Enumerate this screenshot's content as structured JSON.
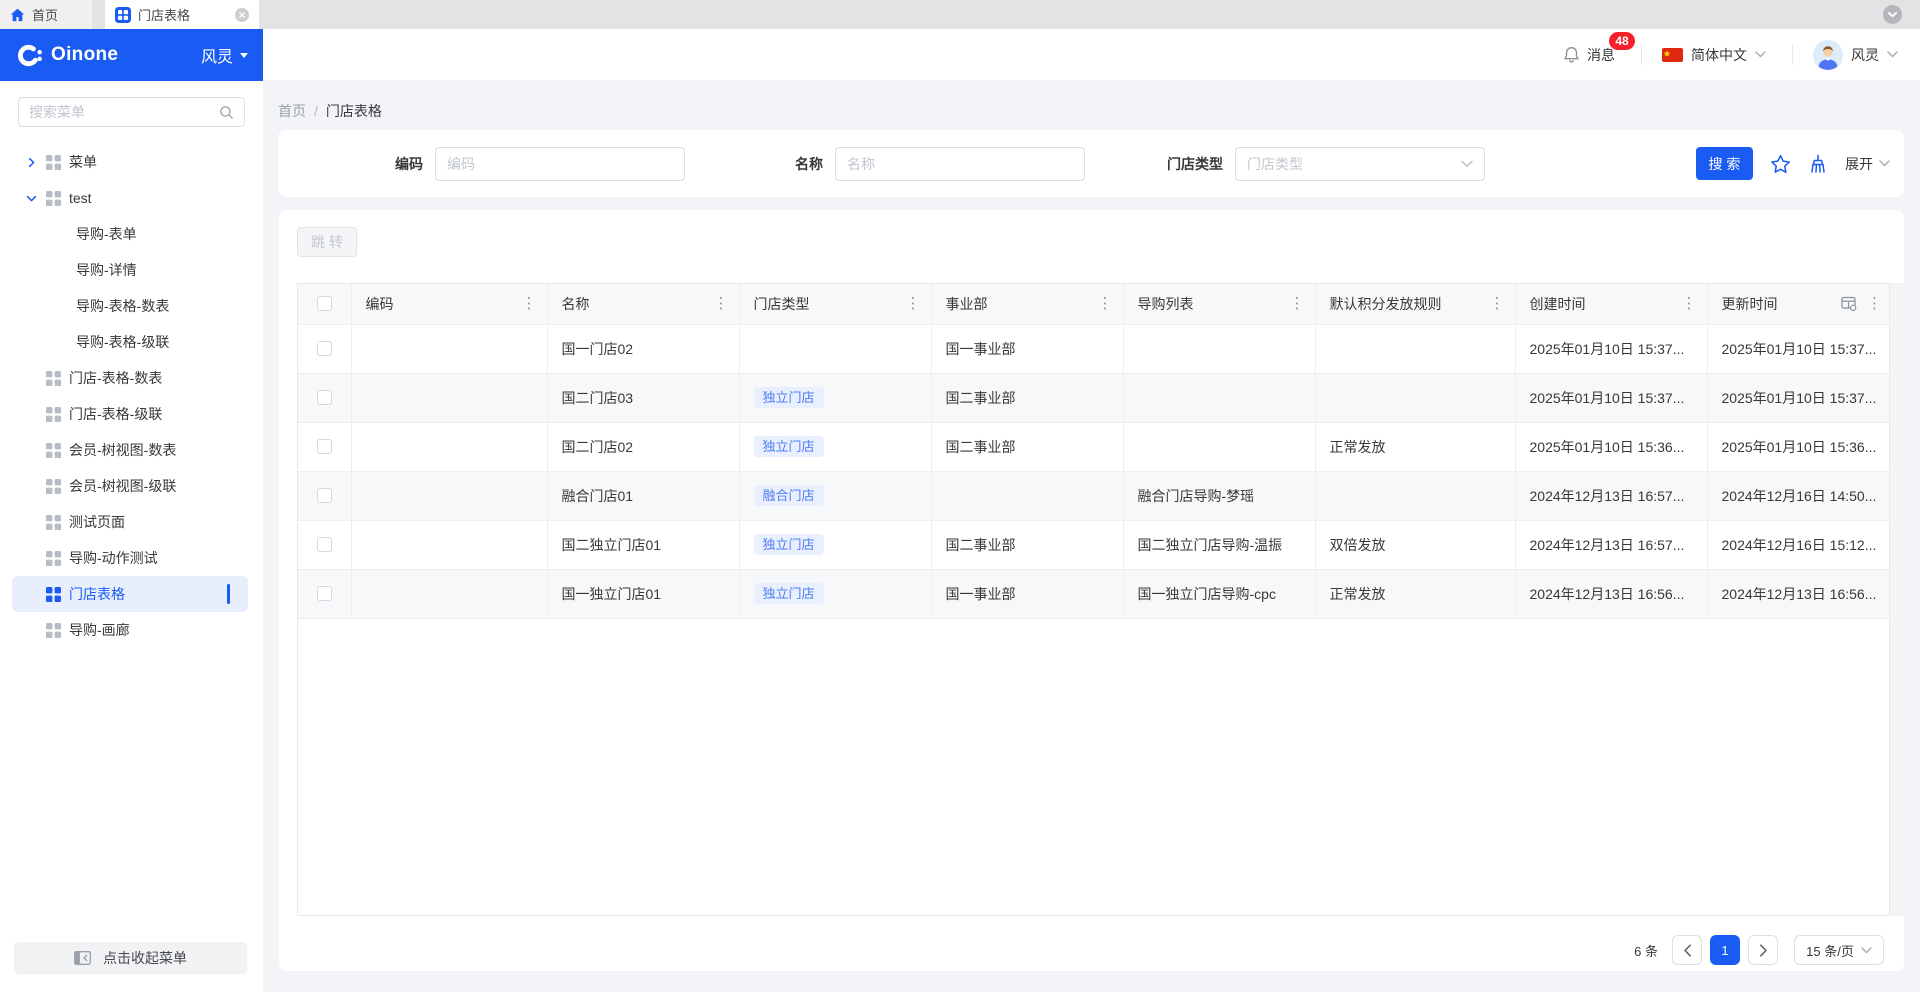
{
  "tab_bar": {
    "tabs": [
      {
        "label": "首页",
        "icon": "home-icon",
        "active": false,
        "closable": false
      },
      {
        "label": "门店表格",
        "icon": "grid-icon",
        "active": true,
        "closable": true
      }
    ]
  },
  "header": {
    "brand": "Oinone",
    "workspace": "风灵",
    "messages": {
      "label": "消息",
      "badge": "48"
    },
    "language": "简体中文",
    "user": "风灵"
  },
  "sidebar": {
    "search_placeholder": "搜索菜单",
    "menu": [
      {
        "label": "菜单",
        "icon": true,
        "chevron": "right",
        "indent": 0,
        "selected": false
      },
      {
        "label": "test",
        "icon": true,
        "chevron": "down",
        "indent": 0,
        "selected": false
      },
      {
        "label": "导购-表单",
        "icon": false,
        "chevron": "",
        "indent": 1,
        "selected": false
      },
      {
        "label": "导购-详情",
        "icon": false,
        "chevron": "",
        "indent": 1,
        "selected": false
      },
      {
        "label": "导购-表格-数表",
        "icon": false,
        "chevron": "",
        "indent": 1,
        "selected": false
      },
      {
        "label": "导购-表格-级联",
        "icon": false,
        "chevron": "",
        "indent": 1,
        "selected": false
      },
      {
        "label": "门店-表格-数表",
        "icon": true,
        "chevron": "",
        "indent": 0,
        "selected": false
      },
      {
        "label": "门店-表格-级联",
        "icon": true,
        "chevron": "",
        "indent": 0,
        "selected": false
      },
      {
        "label": "会员-树视图-数表",
        "icon": true,
        "chevron": "",
        "indent": 0,
        "selected": false
      },
      {
        "label": "会员-树视图-级联",
        "icon": true,
        "chevron": "",
        "indent": 0,
        "selected": false
      },
      {
        "label": "测试页面",
        "icon": true,
        "chevron": "",
        "indent": 0,
        "selected": false
      },
      {
        "label": "导购-动作测试",
        "icon": true,
        "chevron": "",
        "indent": 0,
        "selected": false
      },
      {
        "label": "门店表格",
        "icon": true,
        "chevron": "",
        "indent": 0,
        "selected": true
      },
      {
        "label": "导购-画廊",
        "icon": true,
        "chevron": "",
        "indent": 0,
        "selected": false
      }
    ],
    "collapse_label": "点击收起菜单"
  },
  "breadcrumb": {
    "items": [
      "首页",
      "门店表格"
    ],
    "separator": "/"
  },
  "filter_bar": {
    "fields": [
      {
        "label": "编码",
        "placeholder": "编码",
        "control": "input"
      },
      {
        "label": "名称",
        "placeholder": "名称",
        "control": "input"
      },
      {
        "label": "门店类型",
        "placeholder": "门店类型",
        "control": "select"
      }
    ],
    "search_button": "搜 索",
    "expand_label": "展开"
  },
  "table": {
    "jump_button": "跳 转",
    "columns": [
      "编码",
      "名称",
      "门店类型",
      "事业部",
      "导购列表",
      "默认积分发放规则",
      "创建时间",
      "更新时间"
    ],
    "rows": [
      {
        "code": "",
        "name": "国一门店02",
        "store_type": "",
        "division": "国一事业部",
        "guides": "",
        "rule": "",
        "created": "2025年01月10日 15:37...",
        "updated": "2025年01月10日 15:37..."
      },
      {
        "code": "",
        "name": "国二门店03",
        "store_type": "独立门店",
        "division": "国二事业部",
        "guides": "",
        "rule": "",
        "created": "2025年01月10日 15:37...",
        "updated": "2025年01月10日 15:37..."
      },
      {
        "code": "",
        "name": "国二门店02",
        "store_type": "独立门店",
        "division": "国二事业部",
        "guides": "",
        "rule": "正常发放",
        "created": "2025年01月10日 15:36...",
        "updated": "2025年01月10日 15:36..."
      },
      {
        "code": "",
        "name": "融合门店01",
        "store_type": "融合门店",
        "division": "",
        "guides": "融合门店导购-梦瑶",
        "rule": "",
        "created": "2024年12月13日 16:57...",
        "updated": "2024年12月16日 14:50..."
      },
      {
        "code": "",
        "name": "国二独立门店01",
        "store_type": "独立门店",
        "division": "国二事业部",
        "guides": "国二独立门店导购-温振",
        "rule": "双倍发放",
        "created": "2024年12月13日 16:57...",
        "updated": "2024年12月16日 15:12..."
      },
      {
        "code": "",
        "name": "国一独立门店01",
        "store_type": "独立门店",
        "division": "国一事业部",
        "guides": "国一独立门店导购-cpc",
        "rule": "正常发放",
        "created": "2024年12月13日 16:56...",
        "updated": "2024年12月13日 16:56..."
      }
    ],
    "pagination": {
      "total": "6 条",
      "current_page": "1",
      "page_size": "15 条/页"
    }
  },
  "colors": {
    "primary": "#1a5cf3",
    "badge_bg": "#e9effd",
    "badge_text": "#4d7df5",
    "notify_red": "#f5222d"
  }
}
